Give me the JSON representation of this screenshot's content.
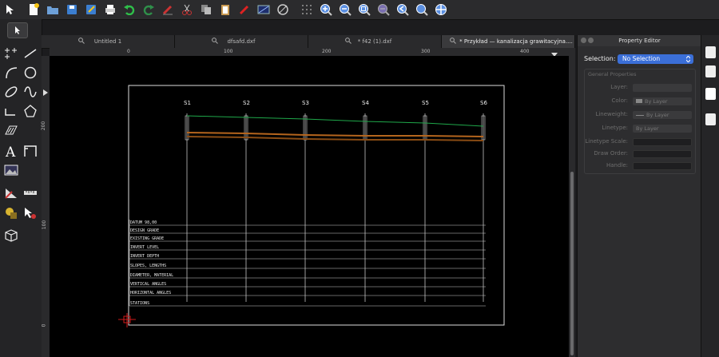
{
  "tabs": [
    {
      "label": "Untitled 1"
    },
    {
      "label": "dfsafd.dxf"
    },
    {
      "label": "* f42 (1).dxf"
    },
    {
      "label": "* Przykład — kanalizacja grawitacyjna...."
    }
  ],
  "rulers": {
    "h": [
      "0",
      "100",
      "200",
      "300",
      "400"
    ],
    "v": [
      "200",
      "100",
      "0"
    ]
  },
  "drawing": {
    "stations": [
      "S1",
      "S2",
      "S3",
      "S4",
      "S5",
      "S6"
    ],
    "row_labels": [
      "DATUM 98,00",
      "DESIGN GRADE",
      "EXISTING GRADE",
      "INVERT LEVEL",
      "INVERT DEPTH",
      "SLOPES, LENGTHS",
      "DIAMETER, MATERIAL",
      "VERTICAL ANGLES",
      "HORIZONTAL ANGLES",
      "STATIONS"
    ]
  },
  "property_editor": {
    "title": "Property Editor",
    "selection_label": "Selection:",
    "selection_value": "No Selection",
    "group_title": "General Properties",
    "rows": [
      {
        "label": "Layer:",
        "value": ""
      },
      {
        "label": "Color:",
        "value": "By Layer"
      },
      {
        "label": "Lineweight:",
        "value": "By Layer"
      },
      {
        "label": "Linetype:",
        "value": "By Layer"
      },
      {
        "label": "Linetype Scale:",
        "value": ""
      },
      {
        "label": "Draw Order:",
        "value": ""
      },
      {
        "label": "Handle:",
        "value": ""
      }
    ]
  },
  "colors": {
    "accent": "#3b6fd8",
    "grade_line": "#1fa84a",
    "pipe": "#b5651d",
    "cursor": "#d11a1a"
  }
}
